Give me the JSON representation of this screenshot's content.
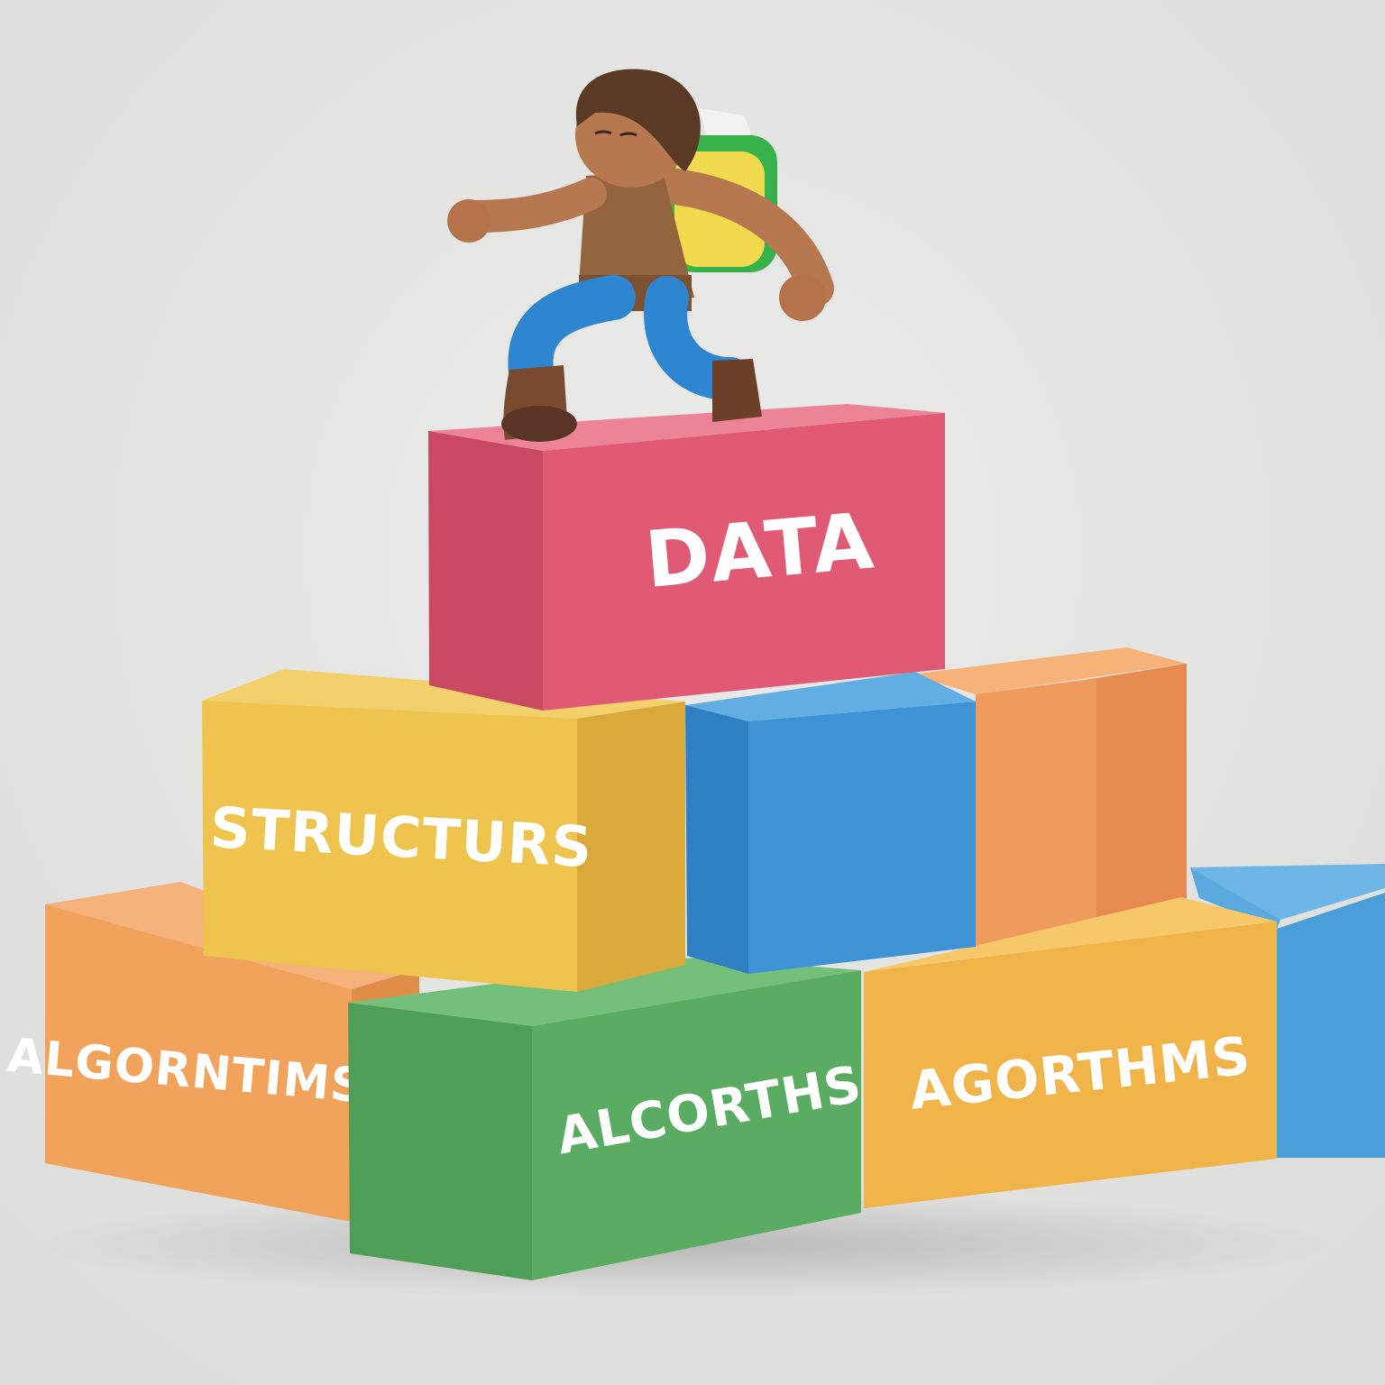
{
  "scene": {
    "background_color": "#e4e4e2",
    "figure": {
      "name": "climbing-figure",
      "hair_color": "#5a3a24",
      "skin_color": "#b7774f",
      "shirt_color": "#94643f",
      "pants_color": "#2f86d0",
      "boot_color": "#5a3424",
      "backpack_colors": [
        "#f1da4e",
        "#37b14a"
      ]
    },
    "blocks": [
      {
        "name": "block-orange-left",
        "color": "#f1a35c",
        "label": "ALGORNTIMS"
      },
      {
        "name": "block-green-front",
        "color": "#5bac63",
        "label": "ALCORTHS"
      },
      {
        "name": "block-yellow-right",
        "color": "#f0b449",
        "label": "AGORTHMS"
      },
      {
        "name": "block-blue-far-right",
        "color": "#4a9fd8",
        "label": ""
      },
      {
        "name": "block-orange-back",
        "color": "#f19a5d",
        "label": ""
      },
      {
        "name": "block-yellow-middle",
        "color": "#eec44f",
        "label": "STRUCTURS"
      },
      {
        "name": "block-blue-middle",
        "color": "#3d93d5",
        "label": ""
      },
      {
        "name": "block-pink-top",
        "color": "#e05a74",
        "label": "DATA"
      }
    ]
  }
}
